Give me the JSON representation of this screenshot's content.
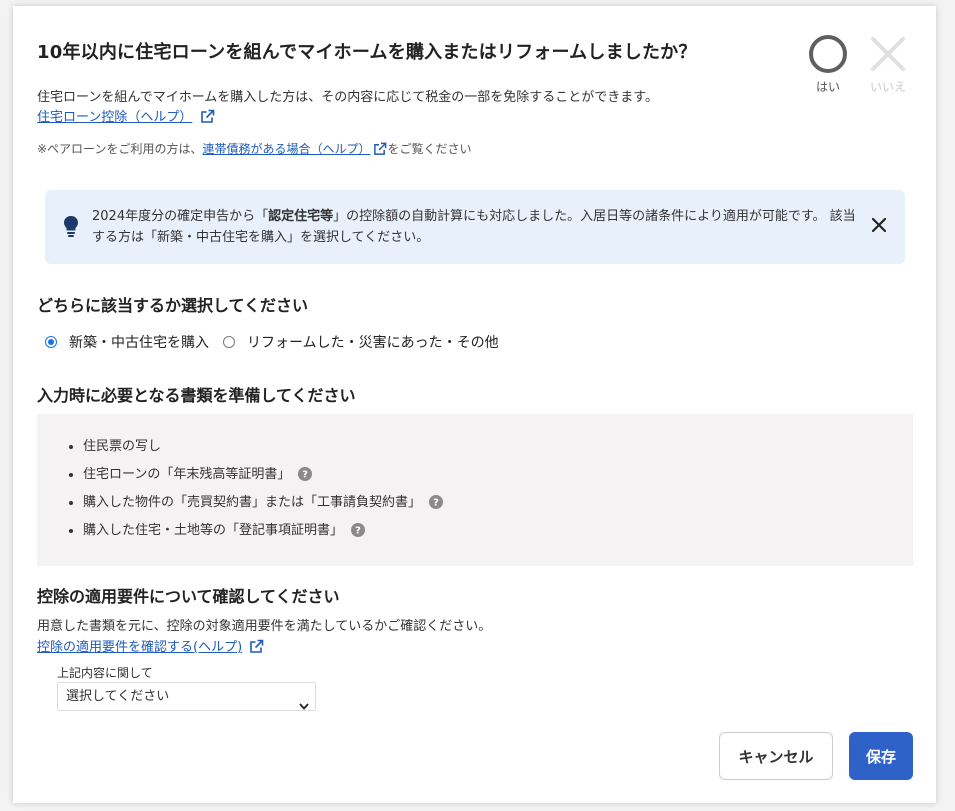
{
  "dialog": {
    "title": "10年以内に住宅ローンを組んでマイホームを購入またはリフォームしましたか？",
    "answers": {
      "yes_label": "はい",
      "no_label": "いいえ"
    },
    "description": "住宅ローンを組んでマイホームを購入した方は、その内容に応じて税金の一部を免除することができます。",
    "help_link_1": "住宅ローン控除（ヘルプ）",
    "note": {
      "prefix": "※ペアローンをご利用の方は、",
      "link": "連帯債務がある場合（ヘルプ）",
      "suffix": "をご覧ください"
    },
    "notice": {
      "part1": "2024年度分の確定申告から「",
      "bold": "認定住宅等",
      "part2": "」の控除額の自動計算にも対応しました。入居日等の諸条件により適用が可能です。 該当する方は「新築・中古住宅を購入」を選択してください。"
    },
    "section_select": {
      "heading": "どちらに該当するか選択してください",
      "options": [
        "新築・中古住宅を購入",
        "リフォームした・災害にあった・その他"
      ],
      "selected_index": 0
    },
    "section_docs": {
      "heading": "入力時に必要となる書類を準備してください",
      "items": [
        "住民票の写し",
        "住宅ローンの「年末残高等証明書」",
        "購入した物件の「売買契約書」または「工事請負契約書」",
        "購入した住宅・土地等の「登記事項証明書」"
      ]
    },
    "section_req": {
      "heading": "控除の適用要件について確認してください",
      "description": "用意した書類を元に、控除の対象適用要件を満たしているかご確認ください。",
      "help_link": "控除の適用要件を確認する(ヘルプ)",
      "select_label": "上記内容に関して",
      "select_value": "選択してください"
    },
    "buttons": {
      "cancel": "キャンセル",
      "save": "保存"
    },
    "colors": {
      "primary": "#2e62c9",
      "link": "#1f5bb8",
      "notice_bg": "#e8f0fb",
      "docs_bg": "#f4f2f2"
    }
  }
}
